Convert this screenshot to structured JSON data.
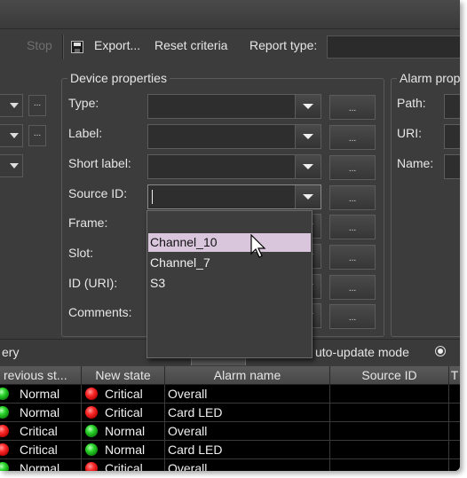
{
  "toolbar": {
    "stop_label": "Stop",
    "export_label": "Export...",
    "reset_label": "Reset criteria",
    "report_type_label": "Report type:"
  },
  "device_properties": {
    "title": "Device properties",
    "labels": [
      "Type:",
      "Label:",
      "Short label:",
      "Source ID:",
      "Frame:",
      "Slot:",
      "ID (URI):",
      "Comments:"
    ],
    "browse_label": "..."
  },
  "alarm_properties": {
    "title": "Alarm prop",
    "labels": [
      "Path:",
      "URI:",
      "Name:"
    ]
  },
  "dropdown": {
    "items": [
      "Channel_10",
      "Channel_7",
      "S3"
    ],
    "selected": "Channel_10"
  },
  "status": {
    "left_text": "ery",
    "auto_update_label": "uto-update mode"
  },
  "table": {
    "columns": [
      "revious st...",
      "New state",
      "Alarm name",
      "Source ID",
      "T"
    ],
    "rows": [
      {
        "prev": "Normal",
        "prev_color": "green",
        "new": "Critical",
        "new_color": "red",
        "alarm": "Overall"
      },
      {
        "prev": "Normal",
        "prev_color": "green",
        "new": "Critical",
        "new_color": "red",
        "alarm": "Card LED"
      },
      {
        "prev": "Critical",
        "prev_color": "red",
        "new": "Normal",
        "new_color": "green",
        "alarm": "Overall"
      },
      {
        "prev": "Critical",
        "prev_color": "red",
        "new": "Normal",
        "new_color": "green",
        "alarm": "Card LED"
      },
      {
        "prev": "Normal",
        "prev_color": "green",
        "new": "Critical",
        "new_color": "red",
        "alarm": "Overall"
      }
    ]
  },
  "colors": {
    "panel": "#3c3c3c",
    "selection": "#d9c6dd",
    "led_red": "#ff2a2a",
    "led_green": "#2ad42a"
  },
  "icons": [
    "save-icon",
    "chevron-down-icon",
    "cursor-arrow-icon",
    "radio-icon",
    "status-led-icon"
  ]
}
